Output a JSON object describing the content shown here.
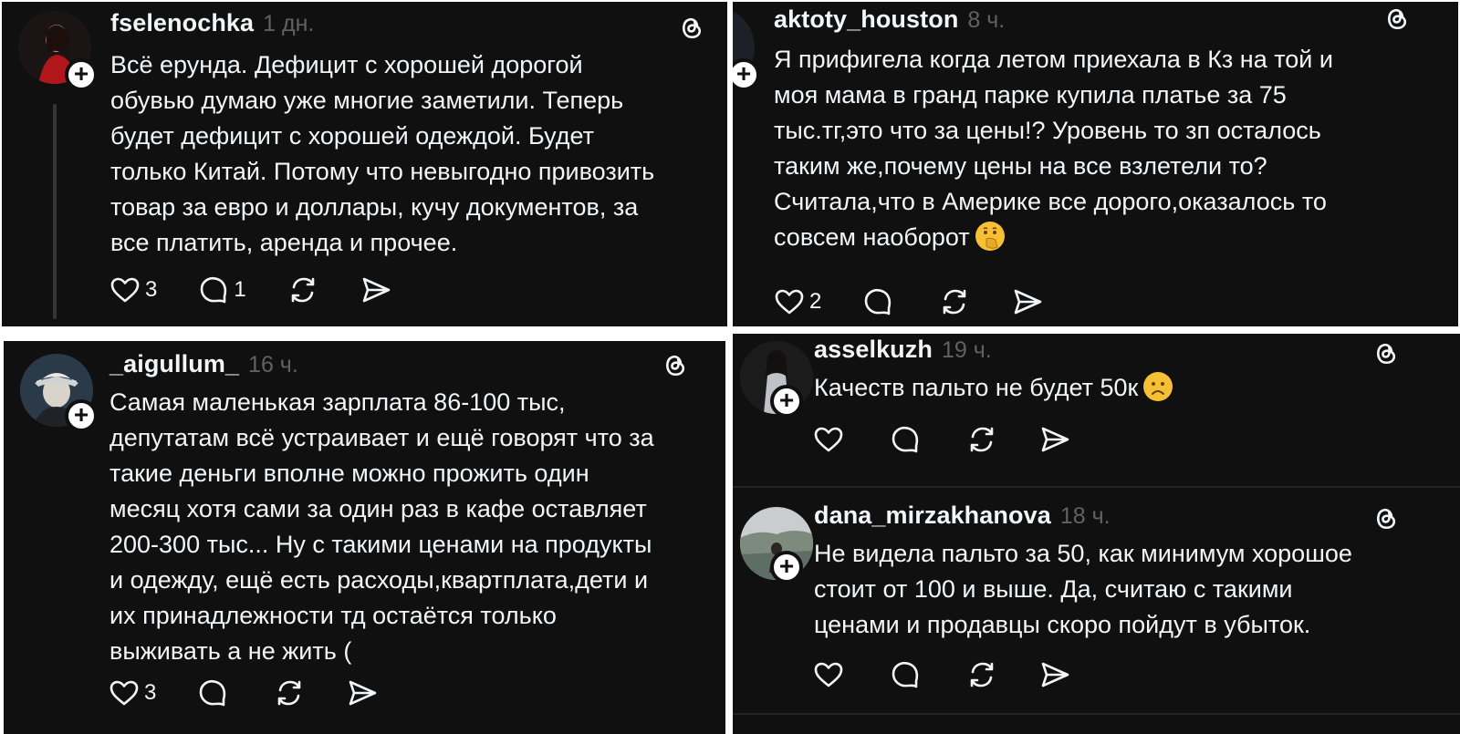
{
  "posts": [
    {
      "username": "fselenochka",
      "time": "1 дн.",
      "text": "Всё ерунда. Дефицит с хорошей дорогой\nобувью думаю уже многие заметили. Теперь\nбудет дефицит с хорошей одеждой. Будет\nтолько Китай. Потому что невыгодно привозить\nтовар за евро и доллары, кучу документов, за\nвсе платить, аренда и прочее.",
      "likes": "3",
      "replies": "1"
    },
    {
      "username": "aktoty_houston",
      "time": "8 ч.",
      "text": "Я прифигела когда летом приехала в Кз на той и\nмоя мама в гранд парке купила платье за 75\nтыс.тг,это что за цены!? Уровень то зп осталось\nтаким же,почему цены на все взлетели то?\nСчитала,что в Америке все дорого,оказалось то\nсовсем наоборот",
      "emoji": "face-with-hand-over-mouth",
      "likes": "2",
      "replies": ""
    },
    {
      "username": "_aigullum_",
      "time": "16 ч.",
      "text": "Самая маленькая зарплата 86-100 тыс,\nдепутатам всё устраивает и ещё говорят что за\nтакие деньги вполне можно прожить один\nмесяц хотя сами за один раз в кафе оставляет\n200-300 тыс... Ну с такими ценами на продукты\nи одежду, ещё есть расходы,квартплата,дети и\nих принадлежности тд остаётся только\nвыживать а не жить (",
      "likes": "3",
      "replies": ""
    },
    {
      "username": "asselkuzh",
      "time": "19 ч.",
      "text": "Качеств пальто не будет 50к",
      "emoji": "frowning-face",
      "likes": "",
      "replies": ""
    },
    {
      "username": "dana_mirzakhanova",
      "time": "18 ч.",
      "text": "Не видела пальто за 50, как минимум хорошое\nстоит от 100 и выше. Да, считаю с такими\nценами и продавцы скоро пойдут в убыток.",
      "likes": "",
      "replies": ""
    }
  ],
  "colors": {
    "background": "#101010",
    "text": "#f3f5f7",
    "muted": "#616161",
    "divider": "#242424",
    "emoji": "#f5c033"
  }
}
